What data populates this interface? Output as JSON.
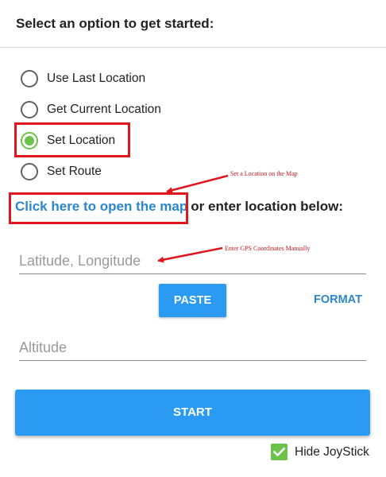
{
  "header": {
    "title": "Select an option to get started:"
  },
  "options": [
    {
      "label": "Use Last Location",
      "checked": false
    },
    {
      "label": "Get Current Location",
      "checked": false
    },
    {
      "label": "Set Location",
      "checked": true
    },
    {
      "label": "Set Route",
      "checked": false
    }
  ],
  "map": {
    "link_text": "Click here to open the map",
    "rest_text": "or enter location below:"
  },
  "annotations": {
    "map_note": "Set a Location on the Map",
    "gps_note": "Enter GPS Coordinates Manually"
  },
  "fields": {
    "coords_placeholder": "Latitude, Longitude",
    "altitude_placeholder": "Altitude"
  },
  "buttons": {
    "paste": "PASTE",
    "format": "FORMAT",
    "start": "START"
  },
  "joystick": {
    "label": "Hide JoyStick",
    "checked": true
  },
  "colors": {
    "accent_blue": "#2b9af3",
    "link_blue": "#2b86cc",
    "check_green": "#6cc24a",
    "annotation_red": "#e0161e"
  }
}
